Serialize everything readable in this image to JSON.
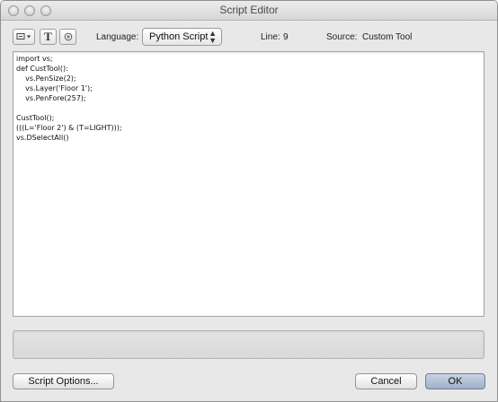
{
  "window": {
    "title": "Script Editor"
  },
  "toolbar": {
    "insert_icon": "insert-dropdown-icon",
    "text_button_label": "T",
    "help_icon": "circle-icon",
    "language_label": "Language:",
    "language_value": "Python Script",
    "line_label": "Line:",
    "line_value": "9",
    "source_label": "Source:",
    "source_value": "Custom Tool"
  },
  "editor": {
    "lines": [
      "import vs;",
      "def CustTool():",
      "    vs.PenSize(2);",
      "    vs.Layer('Floor 1');",
      "    vs.PenFore(257);",
      "",
      "CustTool();",
      "(((L='Floor 2') & (T=LIGHT)));",
      "vs.DSelectAll()"
    ]
  },
  "message_area": {
    "text": ""
  },
  "buttons": {
    "script_options": "Script Options...",
    "cancel": "Cancel",
    "ok": "OK"
  }
}
